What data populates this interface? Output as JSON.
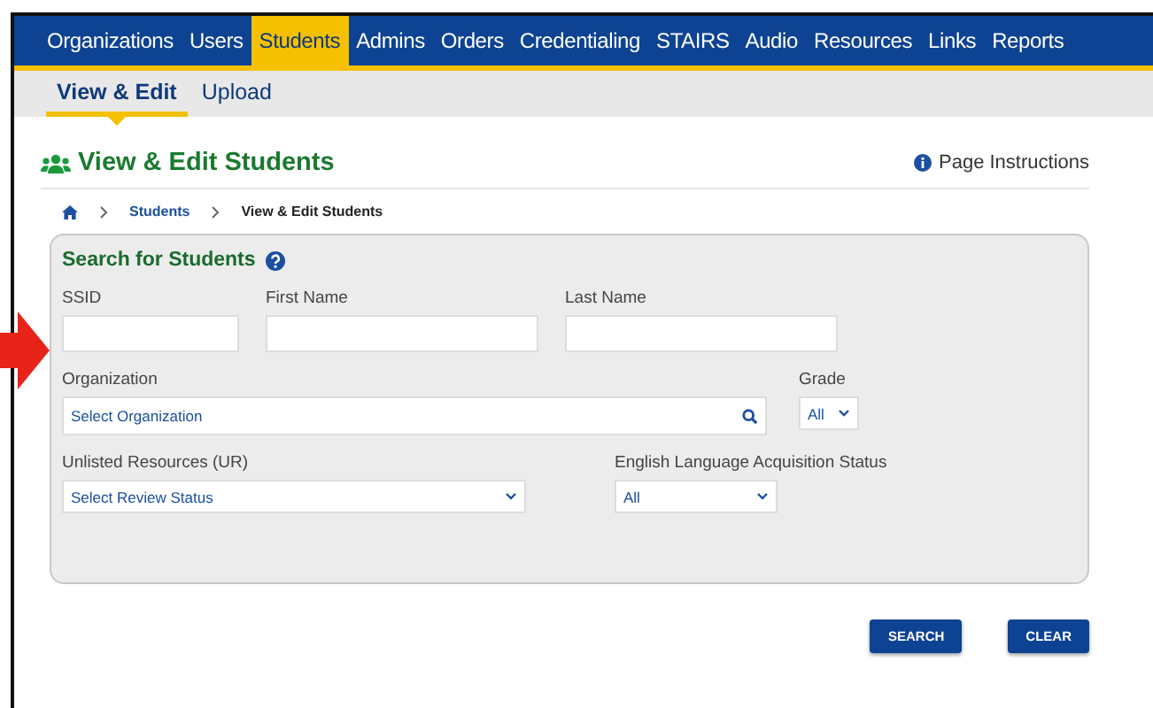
{
  "nav": [
    {
      "label": "Organizations",
      "selected": false
    },
    {
      "label": "Users",
      "selected": false
    },
    {
      "label": "Students",
      "selected": true
    },
    {
      "label": "Admins",
      "selected": false
    },
    {
      "label": "Orders",
      "selected": false
    },
    {
      "label": "Credentialing",
      "selected": false
    },
    {
      "label": "STAIRS",
      "selected": false
    },
    {
      "label": "Audio",
      "selected": false
    },
    {
      "label": "Resources",
      "selected": false
    },
    {
      "label": "Links",
      "selected": false
    },
    {
      "label": "Reports",
      "selected": false
    }
  ],
  "subnav": [
    {
      "label": "View & Edit",
      "selected": true
    },
    {
      "label": "Upload",
      "selected": false
    }
  ],
  "page_title": "View & Edit Students",
  "page_instructions": "Page Instructions",
  "breadcrumb": [
    {
      "kind": "home"
    },
    {
      "kind": "link",
      "label": "Students"
    },
    {
      "kind": "current",
      "label": "View & Edit Students"
    }
  ],
  "search_panel": {
    "title": "Search for Students",
    "rows": [
      [
        {
          "kind": "text",
          "label": "SSID"
        },
        {
          "kind": "text",
          "label": "First Name"
        },
        {
          "kind": "text",
          "label": "Last Name"
        }
      ],
      [
        {
          "kind": "search",
          "label": "Organization",
          "value": "Select Organization"
        },
        {
          "kind": "select",
          "label": "Grade",
          "value": "All"
        }
      ],
      [
        {
          "kind": "select",
          "label": "Unlisted Resources (UR)",
          "value": "Select Review Status"
        },
        {
          "kind": "select",
          "label": "English Language Acquisition Status",
          "value": "All"
        }
      ]
    ]
  },
  "buttons": [
    "SEARCH",
    "CLEAR"
  ]
}
